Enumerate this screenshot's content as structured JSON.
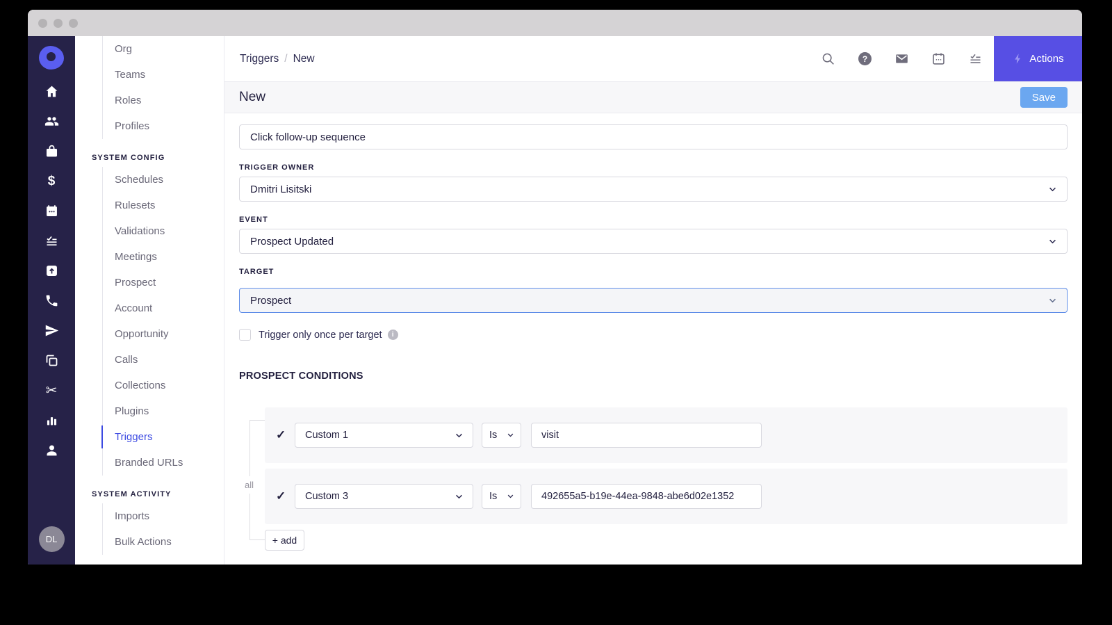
{
  "colors": {
    "rail_bg": "#262248",
    "brand": "#5a5ef0",
    "actions_bg": "#574fe4",
    "save_bg": "#6ba7f0",
    "active_nav": "#3d4be2",
    "focus_border": "#5f8de8",
    "card_bg": "#f7f7f9",
    "titlebar": "#d5d3d5"
  },
  "iconbar": {
    "icons": [
      "home",
      "people",
      "bag",
      "dollar",
      "calendar",
      "tasks",
      "export",
      "phone",
      "send",
      "copy",
      "scissors",
      "chart",
      "person"
    ],
    "avatar_initials": "DL"
  },
  "subnav": {
    "active": "Triggers",
    "groups": [
      {
        "header": null,
        "items": [
          "Org",
          "Teams",
          "Roles",
          "Profiles"
        ]
      },
      {
        "header": "SYSTEM CONFIG",
        "items": [
          "Schedules",
          "Rulesets",
          "Validations",
          "Meetings",
          "Prospect",
          "Account",
          "Opportunity",
          "Calls",
          "Collections",
          "Plugins",
          "Triggers",
          "Branded URLs"
        ]
      },
      {
        "header": "SYSTEM ACTIVITY",
        "items": [
          "Imports",
          "Bulk Actions"
        ]
      }
    ]
  },
  "topbar": {
    "breadcrumb_parent": "Triggers",
    "breadcrumb_sep": "/",
    "breadcrumb_current": "New",
    "icons": [
      "search",
      "help",
      "mail",
      "calendar",
      "tasks"
    ],
    "actions_label": "Actions"
  },
  "pagehead": {
    "title": "New",
    "save_label": "Save"
  },
  "form": {
    "name_value": "Click follow-up sequence",
    "owner_label": "TRIGGER OWNER",
    "owner_value": "Dmitri Lisitski",
    "event_label": "EVENT",
    "event_value": "Prospect Updated",
    "target_label": "TARGET",
    "target_value": "Prospect",
    "once_label": "Trigger only once per target",
    "conditions_title": "PROSPECT CONDITIONS",
    "match_label": "all",
    "conditions": [
      {
        "field": "Custom 1",
        "operator": "Is",
        "value": "visit"
      },
      {
        "field": "Custom 3",
        "operator": "Is",
        "value": "492655a5-b19e-44ea-9848-abe6d02e1352"
      }
    ],
    "add_label": "+ add"
  }
}
